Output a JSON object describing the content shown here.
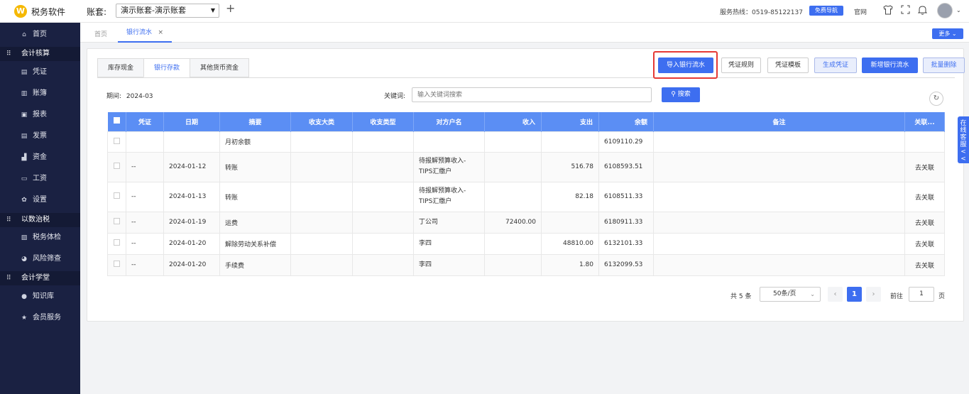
{
  "app": {
    "logo_glyph": "W",
    "title": "税务软件"
  },
  "header": {
    "account_label": "账套:",
    "account_value": "演示账套-演示账套",
    "plus_glyph": "+",
    "hotline": "服务热线：0519-85122137",
    "guide_label": "免费导航",
    "official_label": "官网",
    "icons": [
      "shirt-icon",
      "expand-icon",
      "bell-icon"
    ]
  },
  "sidebar": {
    "items": [
      {
        "type": "item",
        "icon": "home-icon",
        "glyph": "⌂",
        "label": "首页"
      },
      {
        "type": "group",
        "icon": "grid-icon",
        "glyph": "⠿",
        "label": "会计核算"
      },
      {
        "type": "item",
        "icon": "voucher-icon",
        "glyph": "▤",
        "label": "凭证"
      },
      {
        "type": "item",
        "icon": "ledger-icon",
        "glyph": "▥",
        "label": "账簿"
      },
      {
        "type": "item",
        "icon": "report-icon",
        "glyph": "▣",
        "label": "报表"
      },
      {
        "type": "item",
        "icon": "invoice-icon",
        "glyph": "▤",
        "label": "发票"
      },
      {
        "type": "item",
        "icon": "funds-icon",
        "glyph": "▟",
        "label": "资金"
      },
      {
        "type": "item",
        "icon": "salary-icon",
        "glyph": "▭",
        "label": "工资"
      },
      {
        "type": "item",
        "icon": "settings-icon",
        "glyph": "✿",
        "label": "设置"
      },
      {
        "type": "group",
        "icon": "grid-icon",
        "glyph": "⠿",
        "label": "以数治税"
      },
      {
        "type": "item",
        "icon": "checkup-icon",
        "glyph": "▨",
        "label": "税务体检"
      },
      {
        "type": "item",
        "icon": "risk-icon",
        "glyph": "◕",
        "label": "风险筛查"
      },
      {
        "type": "group",
        "icon": "grid-icon",
        "glyph": "⠿",
        "label": "会计学堂"
      },
      {
        "type": "item",
        "icon": "pin-icon",
        "glyph": "●",
        "label": "知识库"
      },
      {
        "type": "item",
        "icon": "star-icon",
        "glyph": "★",
        "label": "会员服务"
      }
    ]
  },
  "tabs": {
    "home": "首页",
    "active": "银行流水",
    "close_glyph": "×",
    "more": "更多 ⌄"
  },
  "subtabs": [
    "库存现金",
    "银行存款",
    "其他货币资金"
  ],
  "actions": {
    "import": "导入银行流水",
    "rules": "凭证规则",
    "template": "凭证模板",
    "generate": "生成凭证",
    "add": "新增银行流水",
    "batch_delete": "批量删除"
  },
  "filters": {
    "period_label": "期间:",
    "period_value": "2024-03",
    "keyword_label": "关键词:",
    "keyword_placeholder": "输入关键词搜索",
    "search_label": "搜索",
    "refresh_glyph": "↻"
  },
  "table": {
    "columns": [
      "凭证",
      "日期",
      "摘要",
      "收支大类",
      "收支类型",
      "对方户名",
      "收入",
      "支出",
      "余额",
      "备注",
      "关联..."
    ],
    "rows": [
      {
        "voucher": "",
        "date": "",
        "summary": "月初余额",
        "major": "",
        "type": "",
        "counterparty": "",
        "income": "",
        "expense": "",
        "balance": "6109110.29",
        "remark": "",
        "link": ""
      },
      {
        "voucher": "--",
        "date": "2024-01-12",
        "summary": "转账",
        "major": "",
        "type": "",
        "counterparty": "待报解预算收入-TIPS汇缴户",
        "income": "",
        "expense": "516.78",
        "balance": "6108593.51",
        "remark": "",
        "link": "去关联"
      },
      {
        "voucher": "--",
        "date": "2024-01-13",
        "summary": "转账",
        "major": "",
        "type": "",
        "counterparty": "待报解预算收入-TIPS汇缴户",
        "income": "",
        "expense": "82.18",
        "balance": "6108511.33",
        "remark": "",
        "link": "去关联"
      },
      {
        "voucher": "--",
        "date": "2024-01-19",
        "summary": "运费",
        "major": "",
        "type": "",
        "counterparty": "丁公司",
        "income": "72400.00",
        "expense": "",
        "balance": "6180911.33",
        "remark": "",
        "link": "去关联"
      },
      {
        "voucher": "--",
        "date": "2024-01-20",
        "summary": "解除劳动关系补偿",
        "major": "",
        "type": "",
        "counterparty": "李四",
        "income": "",
        "expense": "48810.00",
        "balance": "6132101.33",
        "remark": "",
        "link": "去关联"
      },
      {
        "voucher": "--",
        "date": "2024-01-20",
        "summary": "手续费",
        "major": "",
        "type": "",
        "counterparty": "李四",
        "income": "",
        "expense": "1.80",
        "balance": "6132099.53",
        "remark": "",
        "link": "去关联"
      }
    ]
  },
  "pagination": {
    "total": "共 5 条",
    "page_size": "50条/页",
    "prev_glyph": "‹",
    "current": "1",
    "next_glyph": "›",
    "goto_label": "前往",
    "goto_value": "1",
    "unit": "页"
  },
  "online_service": "在线客服<<",
  "colors": {
    "primary": "#3d6ef0",
    "sidebar": "#1a2142",
    "highlight": "#e53935",
    "table_header": "#5b8ef4"
  }
}
